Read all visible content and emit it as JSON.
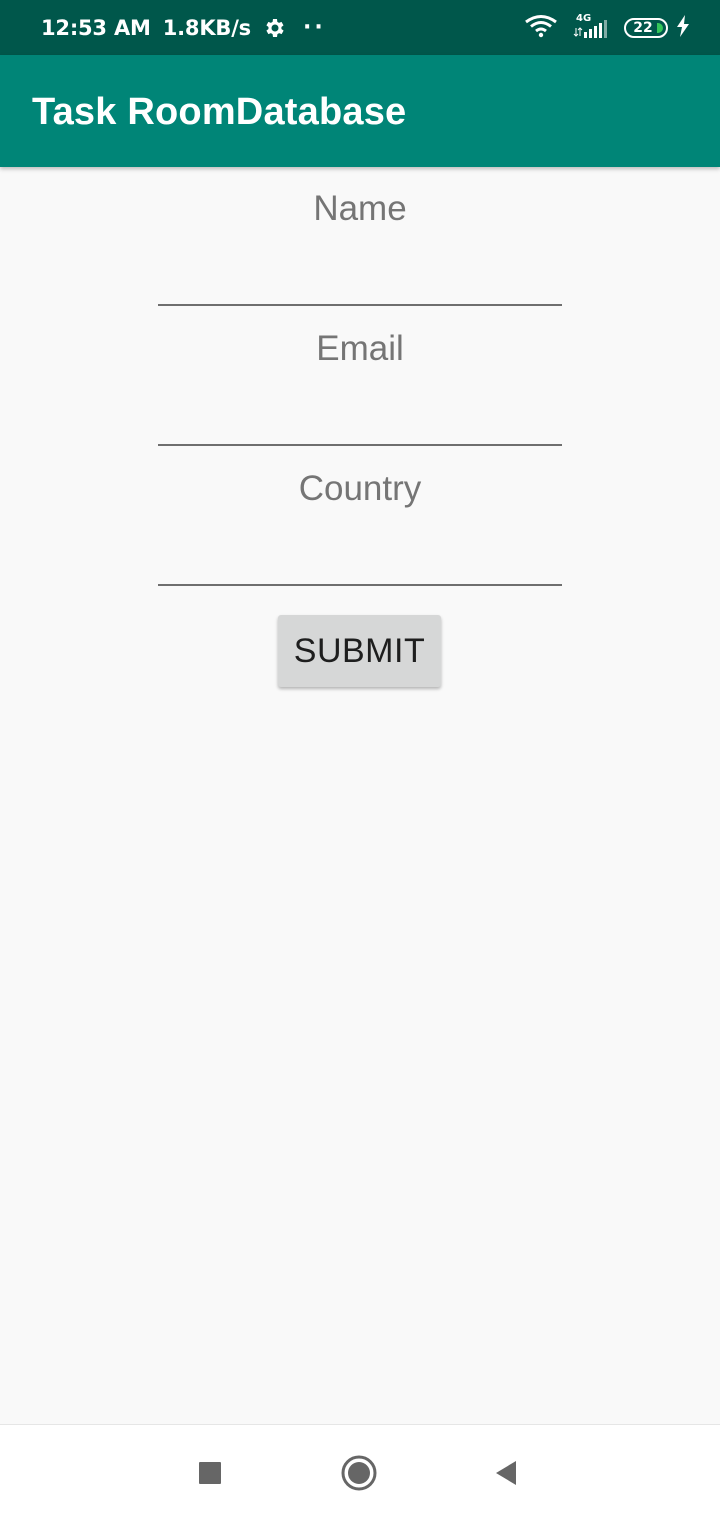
{
  "status_bar": {
    "time": "12:53 AM",
    "network_speed": "1.8KB/s",
    "dots": "··",
    "network_type": "4G",
    "battery_level": "22",
    "icons": [
      "gear-icon",
      "wifi-icon",
      "cellular-signal-icon",
      "battery-icon",
      "charging-bolt-icon"
    ]
  },
  "app_bar": {
    "title": "Task RoomDatabase"
  },
  "form": {
    "name_label": "Name",
    "name_value": "",
    "email_label": "Email",
    "email_value": "",
    "country_label": "Country",
    "country_value": "",
    "submit_label": "SUBMIT"
  },
  "nav_bar": {
    "icons": [
      "recents-square-icon",
      "home-circle-icon",
      "back-triangle-icon"
    ]
  },
  "colors": {
    "status_bar": "#00574b",
    "app_bar": "#008577",
    "background": "#f9f9f9",
    "button": "#d6d7d7",
    "label_text": "#757575",
    "underline": "#6f6f6f"
  }
}
